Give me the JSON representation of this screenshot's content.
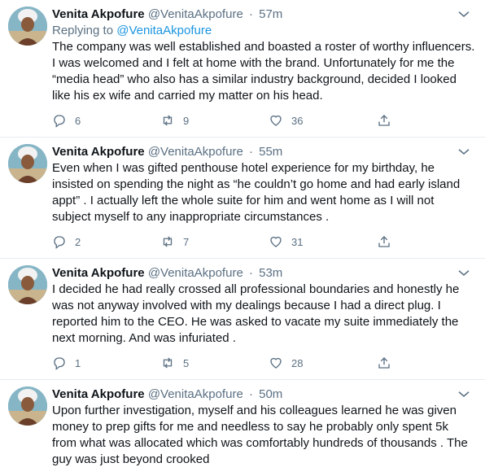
{
  "colors": {
    "accent": "#1b95e0",
    "muted": "#5b7083",
    "text": "#0f1419",
    "divider": "#e6ecf0"
  },
  "tweets": [
    {
      "name": "Venita Akpofure",
      "handle": "@VenitaAkpofure",
      "dot": "·",
      "time": "57m",
      "replying_prefix": "Replying to ",
      "replying_to": "@VenitaAkpofure",
      "text": "The company was well established and boasted a roster of worthy influencers. I was welcomed and I felt at home with the brand. Unfortunately for me the “media head” who also has a similar industry background, decided I looked like his ex wife and carried my matter on his head.",
      "replies": "6",
      "retweets": "9",
      "likes": "36"
    },
    {
      "name": "Venita Akpofure",
      "handle": "@VenitaAkpofure",
      "dot": "·",
      "time": "55m",
      "text": "Even when I was gifted penthouse hotel experience for my birthday, he insisted on spending the night as “he couldn’t go home and had early island appt” . I actually left the whole suite for him and went home as I will not subject myself to any inappropriate circumstances .",
      "replies": "2",
      "retweets": "7",
      "likes": "31"
    },
    {
      "name": "Venita Akpofure",
      "handle": "@VenitaAkpofure",
      "dot": "·",
      "time": "53m",
      "text": "I decided he had really crossed all professional boundaries and honestly he was not anyway involved with my dealings because I had a direct plug. I reported him to the CEO. He was asked to vacate my suite immediately the next morning. And was infuriated .",
      "replies": "1",
      "retweets": "5",
      "likes": "28"
    },
    {
      "name": "Venita Akpofure",
      "handle": "@VenitaAkpofure",
      "dot": "·",
      "time": "50m",
      "text": "Upon further investigation, myself and his colleagues learned he was given money to prep gifts for me and needless to say he probably only spent 5k from what was allocated which was comfortably hundreds of thousands . The guy was just beyond crooked"
    }
  ]
}
